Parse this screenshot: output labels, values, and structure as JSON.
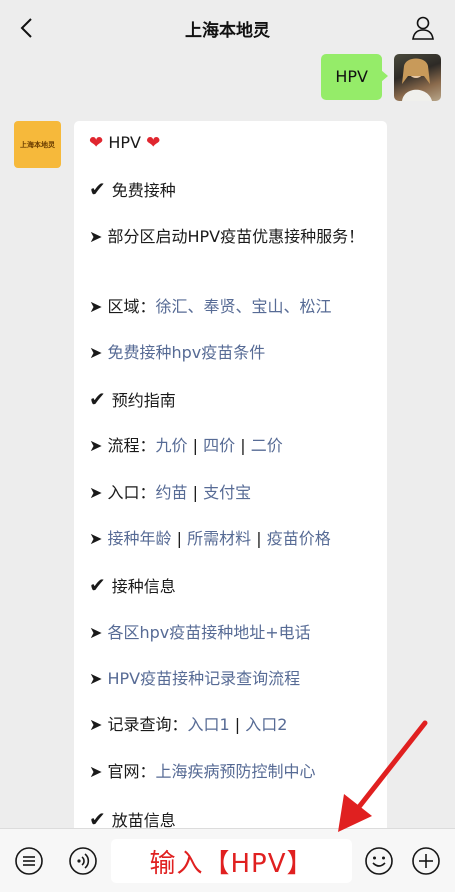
{
  "header": {
    "title": "上海本地灵"
  },
  "outgoing": {
    "text": "HPV"
  },
  "bot": {
    "avatar_text": "上海本地灵"
  },
  "message": {
    "title": "HPV",
    "s1": "免费接种",
    "l1": "部分区启动HPV疫苗优惠接种服务！",
    "l2_label": "区域：",
    "l2_links": "徐汇、奉贤、宝山、松江",
    "l3": "免费接种hpv疫苗条件",
    "s2": "预约指南",
    "l4_label": "流程：",
    "l4_a": "九价",
    "l4_b": "四价",
    "l4_c": "二价",
    "l5_label": "入口：",
    "l5_a": "约苗",
    "l5_b": "支付宝",
    "l6_a": "接种年龄",
    "l6_b": "所需材料",
    "l6_c": "疫苗价格",
    "s3": "接种信息",
    "l7": "各区hpv疫苗接种地址+电话",
    "l8": "HPV疫苗接种记录查询流程",
    "l9_label": "记录查询：",
    "l9_a": "入口1",
    "l9_b": "入口2",
    "l10_label": "官网：",
    "l10_link": "上海疾病预防控制中心",
    "s4": "放苗信息",
    "arrow_marker": "➤",
    "check_marker": "✔",
    "separator": "|"
  },
  "input_bar": {
    "overlay_text": "输入【HPV】"
  },
  "icons": [
    "back-icon",
    "user-icon",
    "menu-icon",
    "voice-icon",
    "emoji-icon",
    "plus-icon"
  ]
}
